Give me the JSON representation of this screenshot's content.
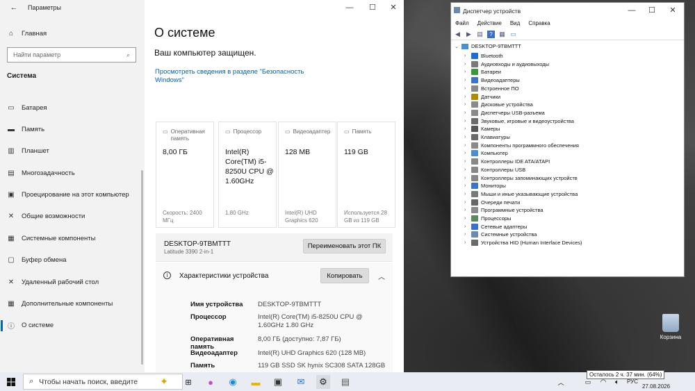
{
  "settings": {
    "title": "Параметры",
    "home": "Главная",
    "search_placeholder": "Найти параметр",
    "section": "Система",
    "nav": [
      "Батарея",
      "Память",
      "Планшет",
      "Многозадачность",
      "Проецирование на этот компьютер",
      "Общие возможности",
      "Системные компоненты",
      "Буфер обмена",
      "Удаленный рабочий стол",
      "Дополнительные компоненты",
      "О системе"
    ],
    "page_title": "О системе",
    "protected": "Ваш компьютер защищен.",
    "security_link": "Просмотреть сведения в разделе \"Безопасность Windows\"",
    "cards": [
      {
        "label": "Оперативная память",
        "value": "8,00 ГБ",
        "sub": "Скорость: 2400 МГц"
      },
      {
        "label": "Процессор",
        "value": "Intel(R) Core(TM) i5-8250U CPU @ 1.60GHz",
        "sub": "1.80 GHz"
      },
      {
        "label": "Видеоадаптер",
        "value": "128 MB",
        "sub": "Intel(R) UHD Graphics 620"
      },
      {
        "label": "Память",
        "value": "119 GB",
        "sub": "Используется 28 GB из 119 GB"
      }
    ],
    "pc_name": "DESKTOP-9TBMTTT",
    "pc_model": "Latitude 3390 2-in-1",
    "rename_btn": "Переименовать этот ПК",
    "specs_title": "Характеристики устройства",
    "copy_btn": "Копировать",
    "specs": [
      {
        "k": "Имя устройства",
        "v": "DESKTOP-9TBMTTT"
      },
      {
        "k": "Процессор",
        "v": "Intel(R) Core(TM) i5-8250U CPU @ 1.60GHz 1.80 GHz"
      },
      {
        "k": "Оперативная память",
        "v": "8,00 ГБ (доступно: 7,87 ГБ)"
      },
      {
        "k": "Видеоадаптер",
        "v": "Intel(R) UHD Graphics 620 (128 MB)"
      },
      {
        "k": "Память",
        "v": "119 GB SSD SK hynix SC308 SATA 128GB"
      }
    ]
  },
  "devmgr": {
    "title": "Диспетчер устройств",
    "menu": [
      "Файл",
      "Действие",
      "Вид",
      "Справка"
    ],
    "root": "DESKTOP-9TBMTTT",
    "items": [
      "Bluetooth",
      "Аудиовходы и аудиовыходы",
      "Батареи",
      "Видеоадаптеры",
      "Встроенное ПО",
      "Датчики",
      "Дисковые устройства",
      "Диспетчеры USB-разъема",
      "Звуковые, игровые и видеоустройства",
      "Камеры",
      "Клавиатуры",
      "Компоненты программного обеспечения",
      "Компьютер",
      "Контроллеры IDE ATA/ATAPI",
      "Контроллеры USB",
      "Контроллеры запоминающих устройств",
      "Мониторы",
      "Мыши и иные указывающие устройства",
      "Очереди печати",
      "Программные устройства",
      "Процессоры",
      "Сетевые адаптеры",
      "Системные устройства",
      "Устройства HID (Human Interface Devices)"
    ],
    "colors": [
      "#1f6fd1",
      "#7a7a7a",
      "#3a9a3a",
      "#3a73c9",
      "#8a8a8a",
      "#b58a00",
      "#8a8a8a",
      "#8a8a8a",
      "#6a6a6a",
      "#555555",
      "#6a6a6a",
      "#8a8a8a",
      "#4a8fd0",
      "#888888",
      "#888888",
      "#888888",
      "#3a73c9",
      "#7a7a7a",
      "#666666",
      "#8a8a8a",
      "#5a8a5a",
      "#3a73c9",
      "#6a8ab0",
      "#6a6a6a"
    ]
  },
  "taskbar": {
    "search": "Чтобы начать поиск, введите",
    "lang": "РУС",
    "date": "27.08.2026",
    "battery_tip": "Осталось 2 ч. 37 мин. (64%)"
  },
  "desktop": {
    "bin": "Корзина"
  }
}
